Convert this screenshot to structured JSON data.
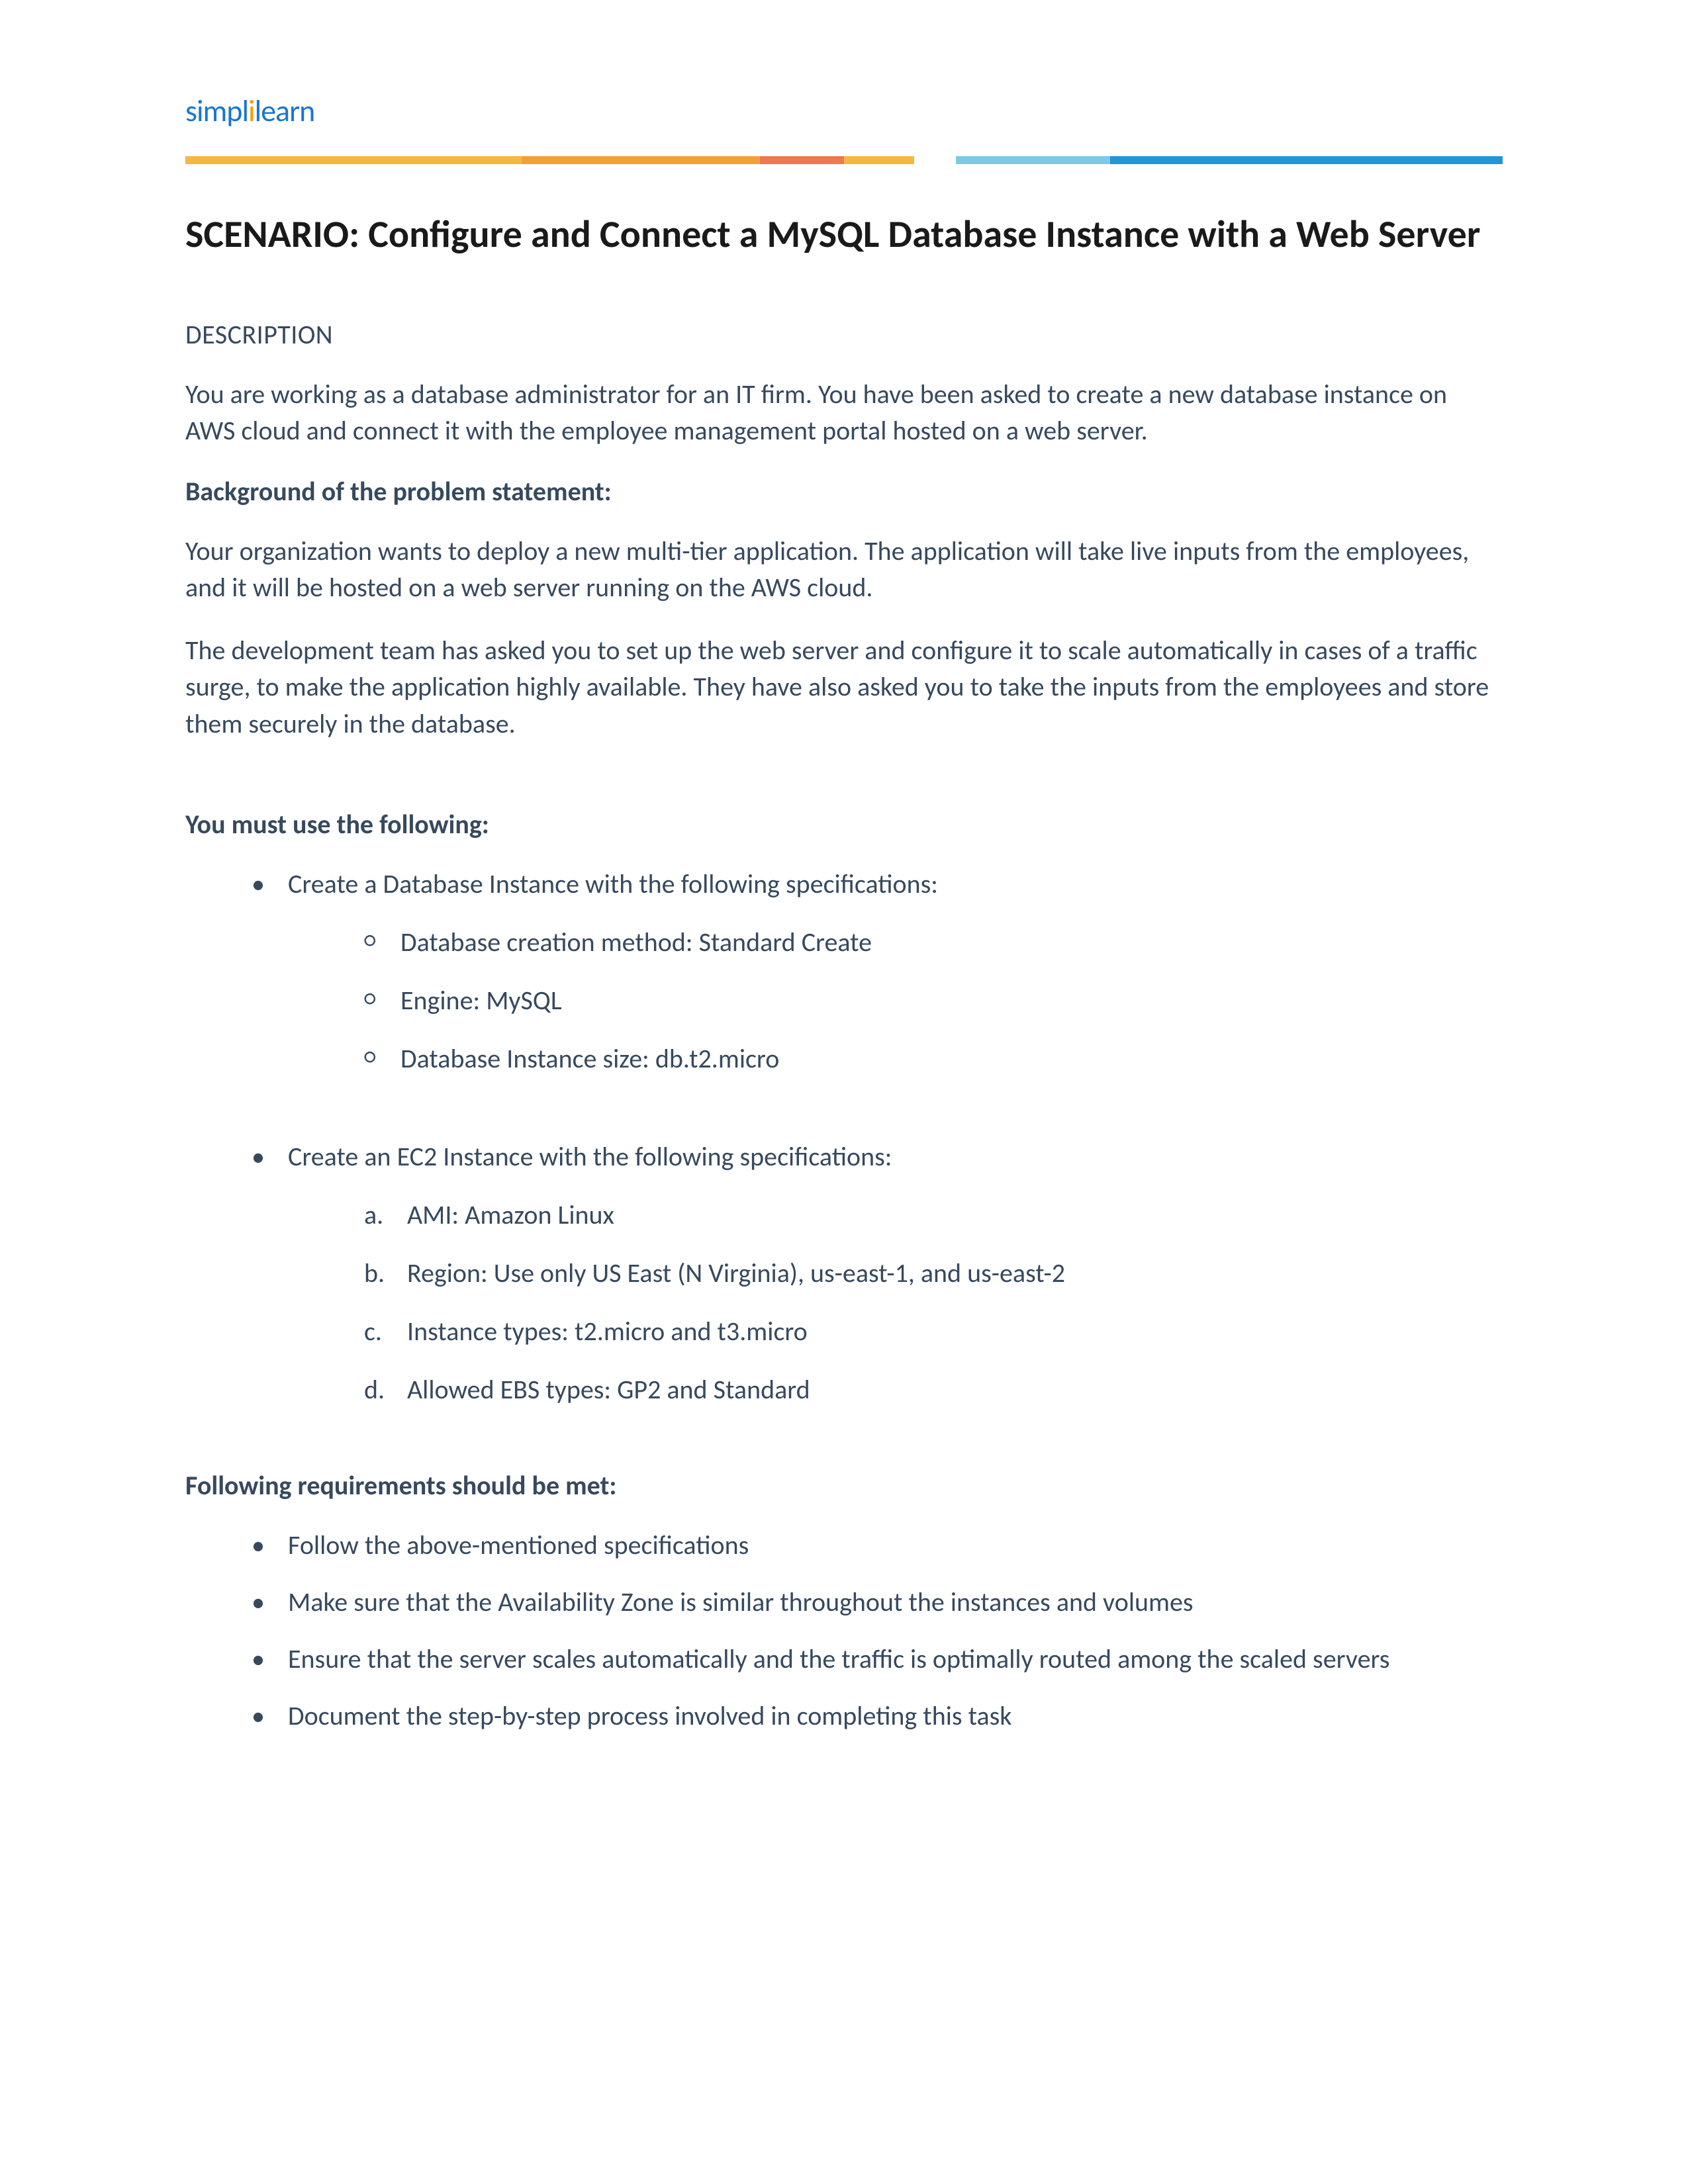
{
  "logo": {
    "part1": "simpl",
    "part2": "i",
    "part3": "learn"
  },
  "title": "SCENARIO: Configure and Connect a MySQL Database Instance with a Web Server",
  "descriptionHeading": "DESCRIPTION",
  "descriptionText": "You are working as a database administrator for an IT firm. You have been asked to create a new database instance on AWS cloud and connect it with the employee management portal hosted on a web server.",
  "backgroundHeading": "Background of the problem statement:",
  "backgroundPara1": "Your organization wants to deploy a new multi-tier application. The application will take live inputs from the employees, and it will be hosted on a web server running on the AWS cloud.",
  "backgroundPara2": "The development team has asked you to set up the web server and configure it to scale automatically in cases of a traffic surge, to make the application highly available. They have also asked you to take the inputs from the employees and store them securely in the database.",
  "mustUseHeading": "You must use the following:",
  "dbInstanceIntro": "Create a Database Instance with the following specifications:",
  "dbSpecs": [
    "Database creation method: Standard Create",
    "Engine: MySQL",
    "Database Instance size: db.t2.micro"
  ],
  "ec2InstanceIntro": "Create an EC2 Instance with the following specifications:",
  "ec2Specs": [
    {
      "marker": "a.",
      "text": "AMI: Amazon Linux"
    },
    {
      "marker": "b.",
      "text": "Region: Use only US East (N Virginia), us-east-1, and us-east-2"
    },
    {
      "marker": "c.",
      "text": "Instance types: t2.micro and t3.micro"
    },
    {
      "marker": "d.",
      "text": "Allowed EBS types: GP2 and Standard"
    }
  ],
  "requirementsHeading": "Following requirements should be met:",
  "requirements": [
    "Follow the above-mentioned specifications",
    "Make sure that the Availability Zone is similar throughout the instances and volumes",
    "Ensure that the server scales automatically and the traffic is optimally routed among the scaled servers",
    "Document the step-by-step process involved in completing this task"
  ]
}
